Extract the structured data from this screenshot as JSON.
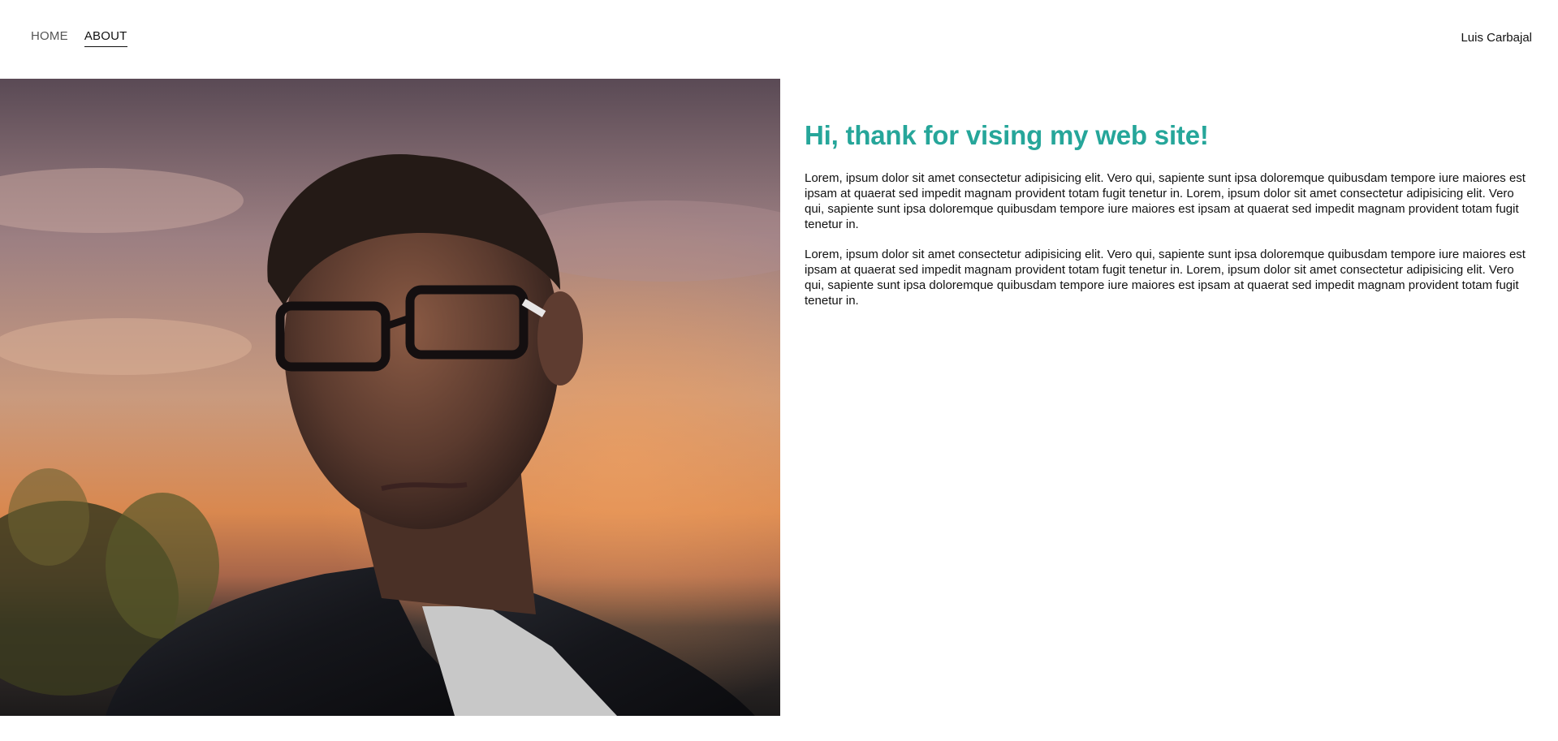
{
  "nav": {
    "items": [
      {
        "label": "HOME",
        "active": false
      },
      {
        "label": "ABOUT",
        "active": true
      }
    ]
  },
  "brand": {
    "name": "Luis Carbajal"
  },
  "hero": {
    "image_description_icon": "portrait-photo"
  },
  "about": {
    "heading": "Hi, thank for vising my web site!",
    "paragraphs": [
      "Lorem, ipsum dolor sit amet consectetur adipisicing elit. Vero qui, sapiente sunt ipsa doloremque quibusdam tempore iure maiores est ipsam at quaerat sed impedit magnam provident totam fugit tenetur in. Lorem, ipsum dolor sit amet consectetur adipisicing elit. Vero qui, sapiente sunt ipsa doloremque quibusdam tempore iure maiores est ipsam at quaerat sed impedit magnam provident totam fugit tenetur in.",
      "Lorem, ipsum dolor sit amet consectetur adipisicing elit. Vero qui, sapiente sunt ipsa doloremque quibusdam tempore iure maiores est ipsam at quaerat sed impedit magnam provident totam fugit tenetur in. Lorem, ipsum dolor sit amet consectetur adipisicing elit. Vero qui, sapiente sunt ipsa doloremque quibusdam tempore iure maiores est ipsam at quaerat sed impedit magnam provident totam fugit tenetur in."
    ]
  },
  "colors": {
    "accent": "#26a69a",
    "text": "#111111",
    "nav_inactive": "#555555"
  }
}
